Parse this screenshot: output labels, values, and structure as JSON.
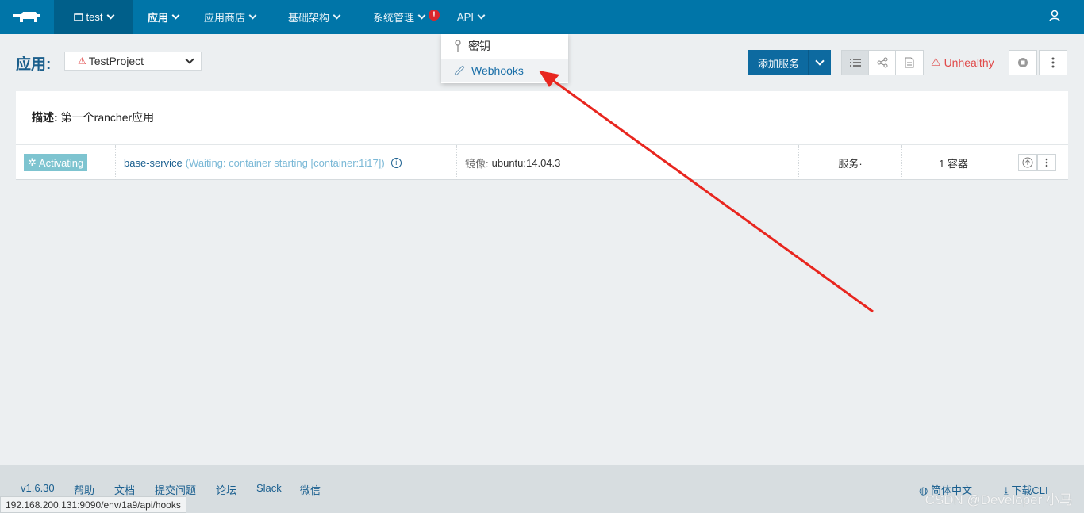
{
  "nav": {
    "env_label": "test",
    "items": [
      "应用",
      "应用商店",
      "基础架构",
      "系统管理",
      "API"
    ],
    "alert_badge": "!"
  },
  "api_menu": {
    "items": [
      "密钥",
      "Webhooks"
    ]
  },
  "page": {
    "title": "应用:",
    "stack_name": "TestProject",
    "add_service_label": "添加服务",
    "health_label": "Unhealthy",
    "description_label": "描述:",
    "description_text": "第一个rancher应用"
  },
  "service": {
    "state": "Activating",
    "name": "base-service",
    "status": "(Waiting: container starting [container:1i17])",
    "image_label": "镜像:",
    "image": "ubuntu:14.04.3",
    "type": "服务·",
    "containers": "1 容器"
  },
  "footer": {
    "version": "v1.6.30",
    "links": [
      "帮助",
      "文档",
      "提交问题",
      "论坛",
      "Slack",
      "微信"
    ],
    "language": "简体中文",
    "download": "下载CLI",
    "status_url": "192.168.200.131:9090/env/1a9/api/hooks",
    "watermark": "CSDN @Developer 小马"
  },
  "colors": {
    "nav_bg": "#0075a8",
    "accent": "#0d6aa0",
    "warn": "#e04b4b",
    "activating": "#7ec4d0"
  }
}
